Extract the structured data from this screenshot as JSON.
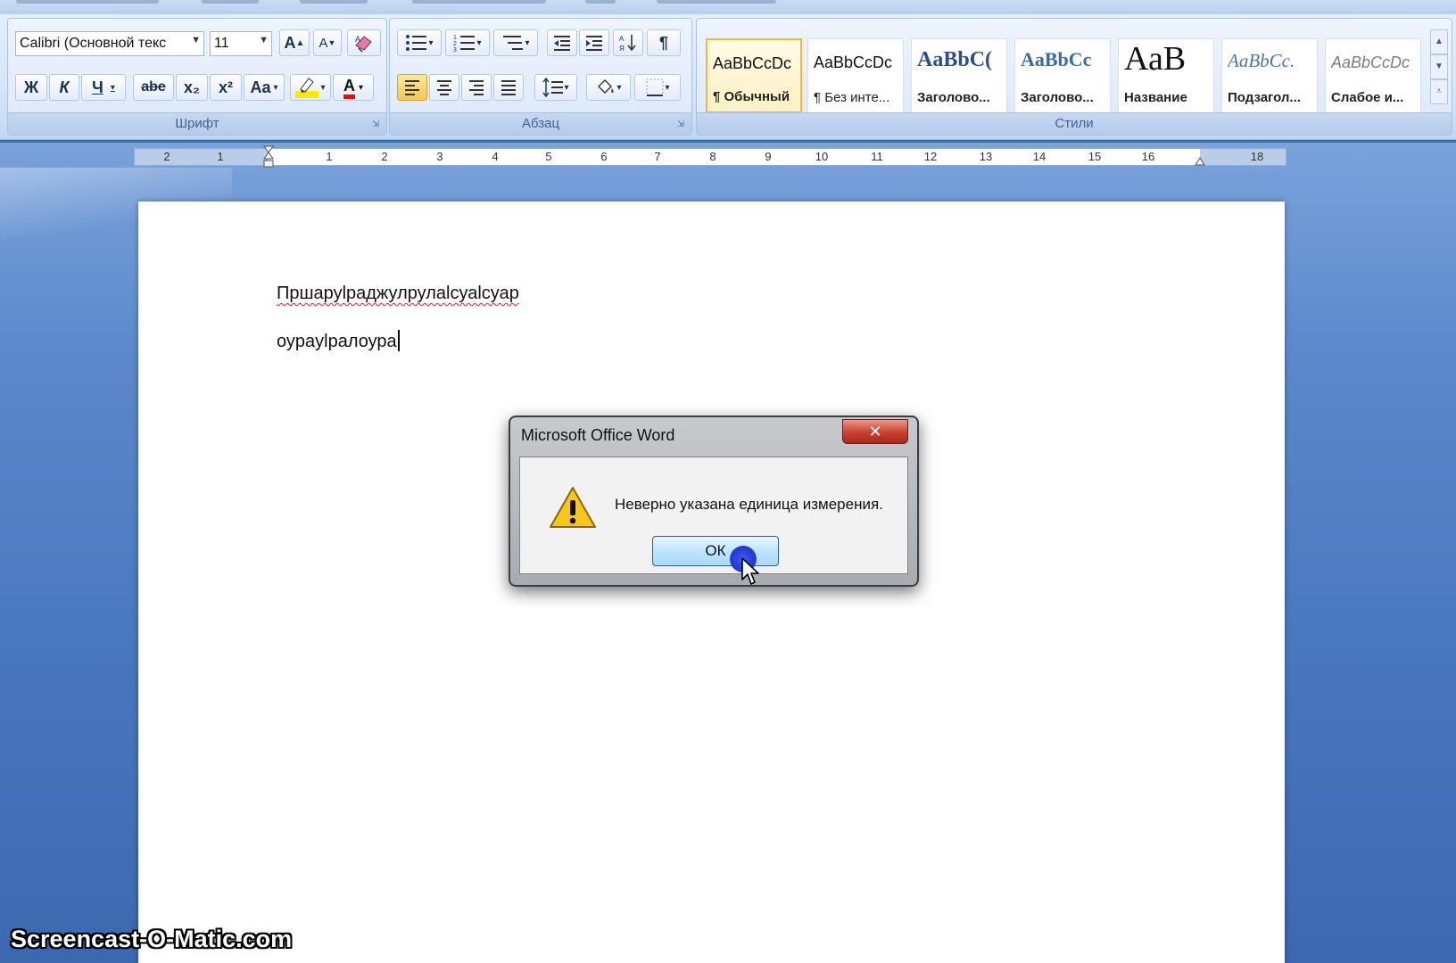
{
  "ribbon": {
    "font_group": {
      "label": "Шрифт",
      "font_name": "Calibri (Основной текс",
      "font_size": "11",
      "bold": "Ж",
      "italic": "К",
      "underline": "Ч",
      "strikethrough": "abe",
      "subscript": "x₂",
      "superscript": "x²",
      "change_case": "Aa",
      "grow_font": "A",
      "shrink_font": "A",
      "font_color": "A"
    },
    "paragraph_group": {
      "label": "Абзац",
      "pilcrow": "¶"
    },
    "styles_group": {
      "label": "Стили",
      "tiles": [
        {
          "sample": "AaBbCcDc",
          "name": "¶ Обычный"
        },
        {
          "sample": "AaBbCcDc",
          "name": "¶ Без инте..."
        },
        {
          "sample": "AaBbC(",
          "name": "Заголово..."
        },
        {
          "sample": "AaBbCc",
          "name": "Заголово..."
        },
        {
          "sample": "АаВ",
          "name": "Название"
        },
        {
          "sample": "AaBbCc.",
          "name": "Подзагол..."
        },
        {
          "sample": "AaBbCcDc",
          "name": "Слабое и..."
        }
      ]
    }
  },
  "ruler": {
    "numbers": [
      "2",
      "1",
      "1",
      "2",
      "3",
      "4",
      "5",
      "6",
      "7",
      "8",
      "9",
      "10",
      "11",
      "12",
      "13",
      "14",
      "15",
      "16",
      "18"
    ]
  },
  "document": {
    "line1": "Пршаруlраджулрулаlсуаlсуар",
    "line2": "оуpaуlралоура"
  },
  "dialog": {
    "title": "Microsoft Office Word",
    "close": "✕",
    "message": "Неверно указана единица измерения.",
    "ok_label": "ОК"
  },
  "watermark": "Screencast-O-Matic.com",
  "colors": {
    "accent": "#f3b640",
    "error_underline": "#e02424",
    "highlight": "#ffe800",
    "font_color": "#e01010"
  }
}
